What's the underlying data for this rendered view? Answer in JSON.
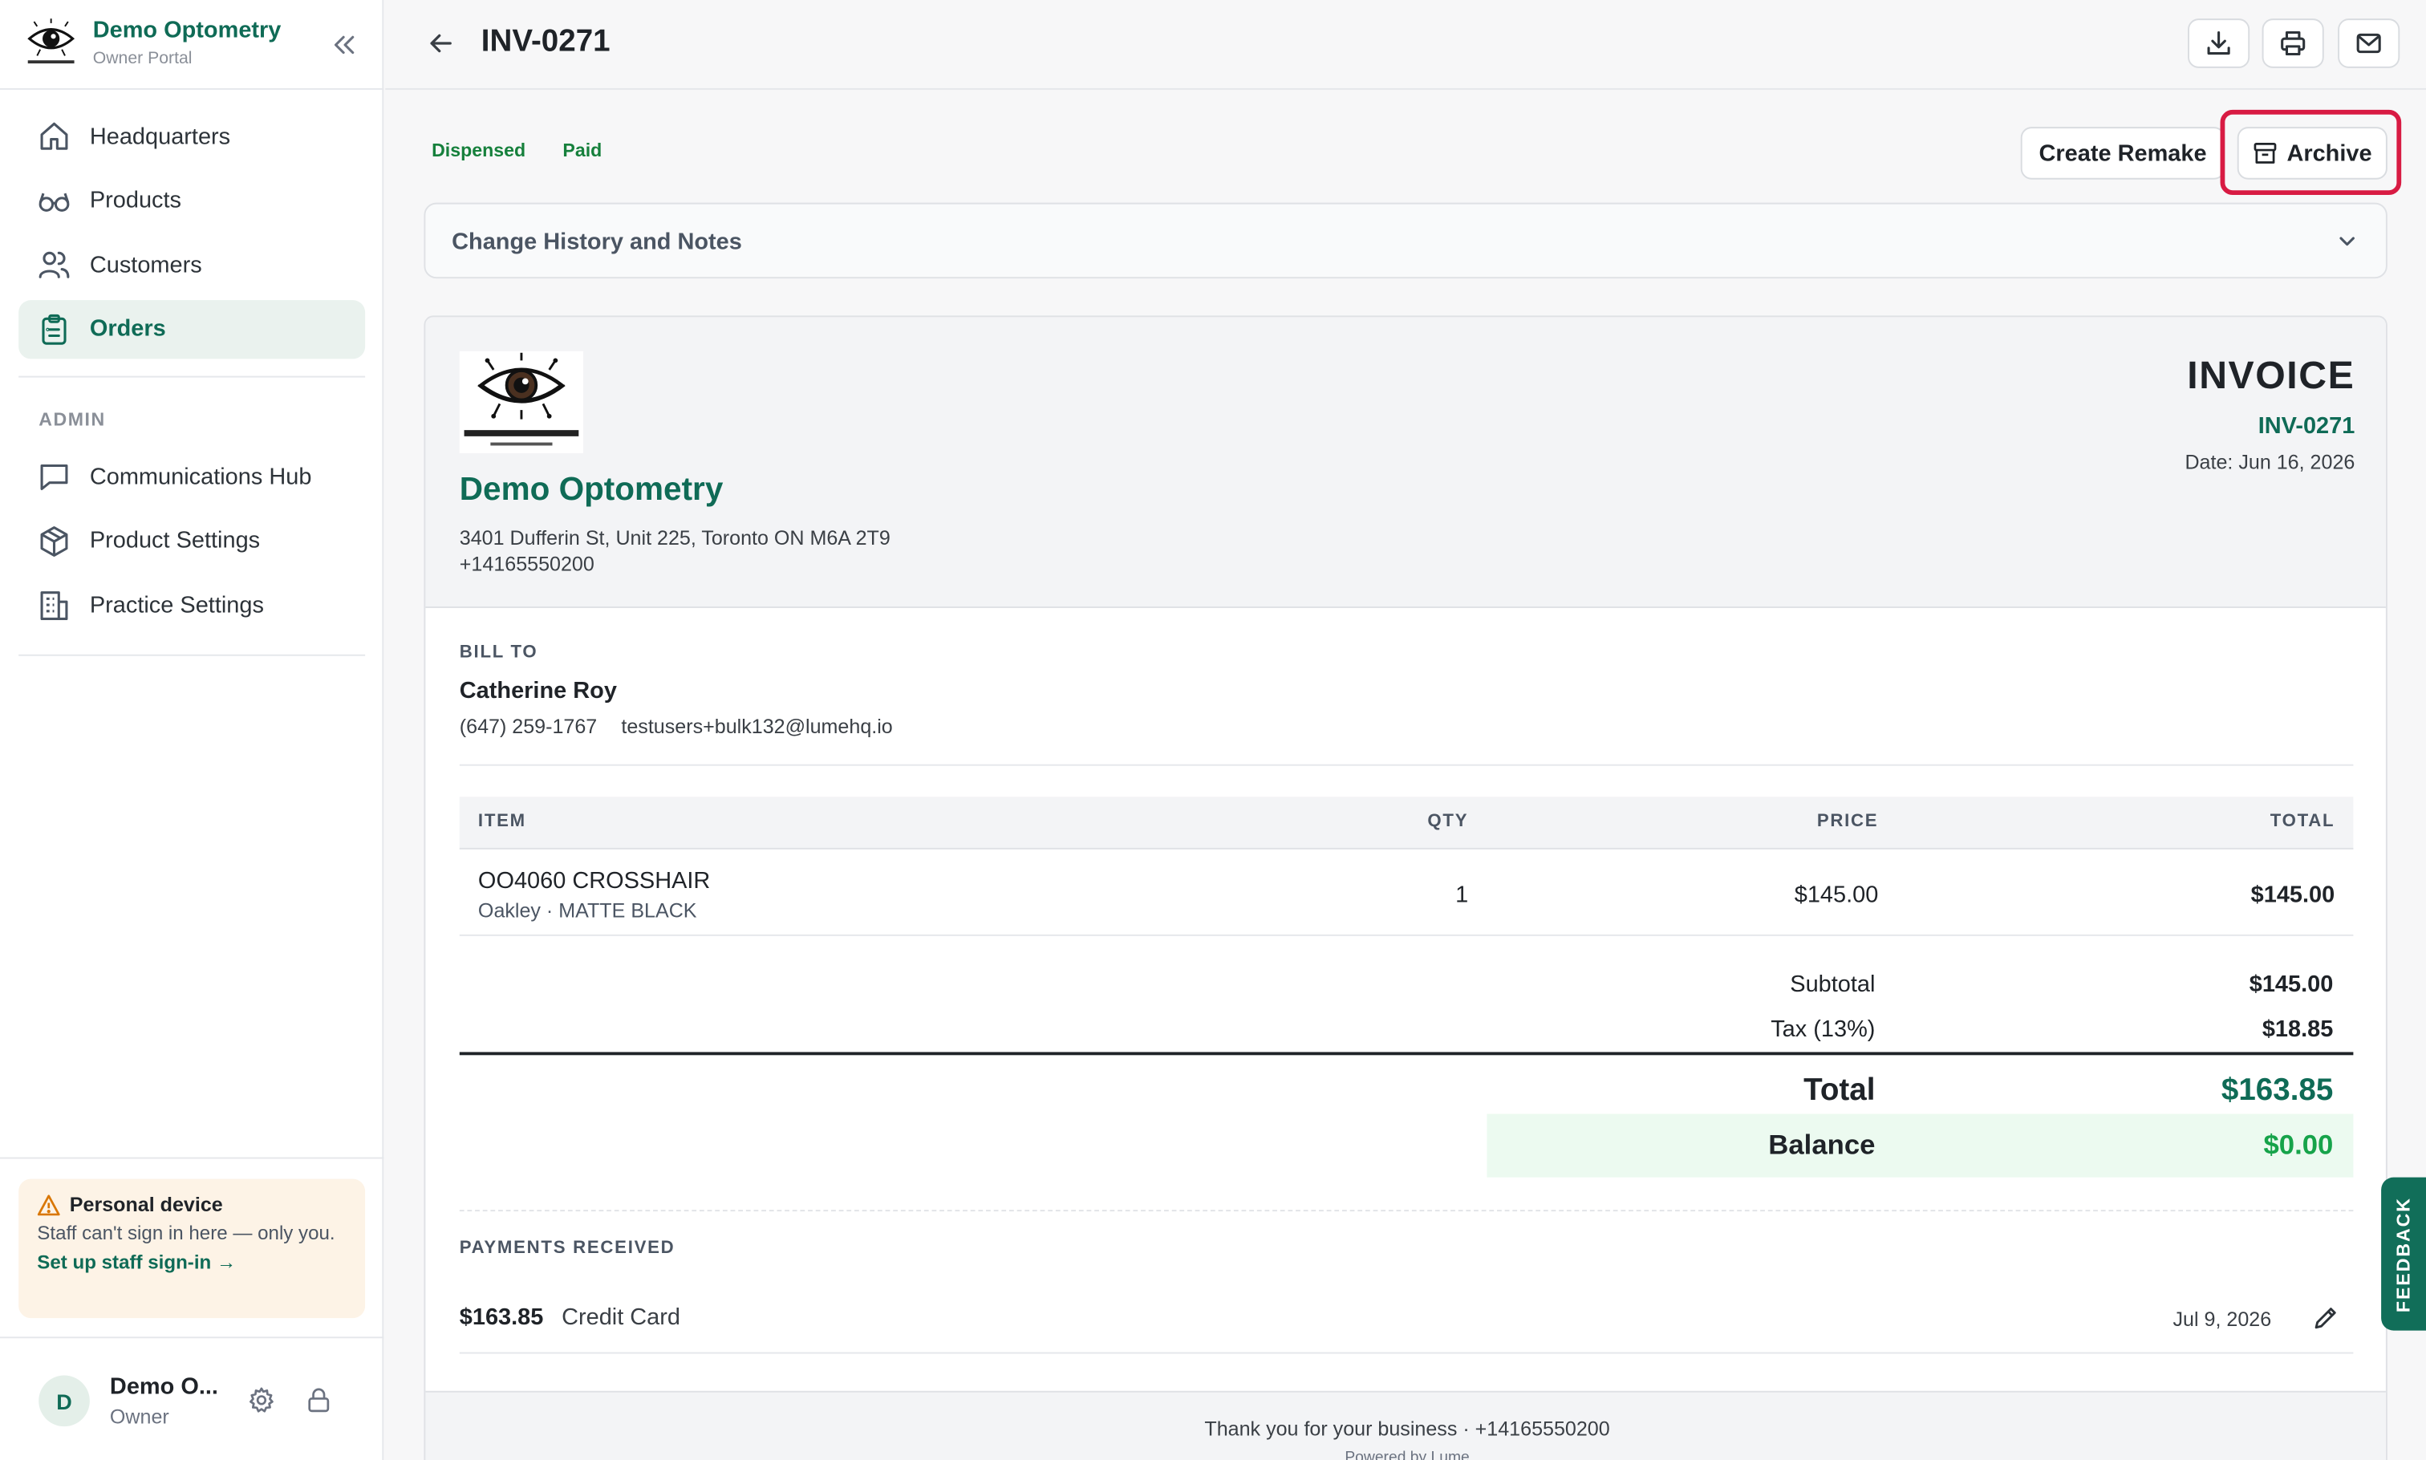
{
  "brand": {
    "name": "Demo Optometry",
    "subtitle": "Owner Portal"
  },
  "nav": [
    {
      "label": "Headquarters",
      "icon": "home-icon",
      "active": false
    },
    {
      "label": "Products",
      "icon": "glasses-icon",
      "active": false
    },
    {
      "label": "Customers",
      "icon": "users-icon",
      "active": false
    },
    {
      "label": "Orders",
      "icon": "clipboard-icon",
      "active": true
    }
  ],
  "admin": {
    "section_label": "ADMIN",
    "items": [
      {
        "label": "Communications Hub",
        "icon": "message-icon"
      },
      {
        "label": "Product Settings",
        "icon": "box-icon"
      },
      {
        "label": "Practice Settings",
        "icon": "building-icon"
      }
    ]
  },
  "device_notice": {
    "title": "Personal device",
    "text": "Staff can't sign in here — only you.",
    "link": "Set up staff sign-in →"
  },
  "user": {
    "initial": "D",
    "name": "Demo O...",
    "role": "Owner"
  },
  "header": {
    "title": "INV-0271"
  },
  "status_badges": [
    "Dispensed",
    "Paid"
  ],
  "actions": {
    "remake": "Create Remake",
    "archive": "Archive"
  },
  "accordion": {
    "title": "Change History and Notes"
  },
  "invoice": {
    "heading": "INVOICE",
    "number": "INV-0271",
    "date": "Date: Jun 16, 2026",
    "company": "Demo Optometry",
    "address": "3401 Dufferin St, Unit 225, Toronto ON M6A 2T9",
    "phone": "+14165550200",
    "bill_to_label": "BILL TO",
    "customer": {
      "name": "Catherine Roy",
      "phone": "(647) 259-1767",
      "email": "testusers+bulk132@lumehq.io"
    },
    "columns": {
      "item": "ITEM",
      "qty": "QTY",
      "price": "PRICE",
      "total": "TOTAL"
    },
    "items": [
      {
        "name": "OO4060 CROSSHAIR",
        "detail": "Oakley · MATTE BLACK",
        "qty": "1",
        "price": "$145.00",
        "total": "$145.00"
      }
    ],
    "subtotal_label": "Subtotal",
    "subtotal": "$145.00",
    "tax_label": "Tax (13%)",
    "tax": "$18.85",
    "total_label": "Total",
    "total": "$163.85",
    "balance_label": "Balance",
    "balance": "$0.00",
    "payments_label": "PAYMENTS RECEIVED",
    "payments": [
      {
        "amount": "$163.85",
        "method": "Credit Card",
        "date": "Jul 9, 2026"
      }
    ],
    "footer_text": "Thank you for your business · +14165550200",
    "footer_sub": "Powered by Lume"
  },
  "feedback_label": "FEEDBACK",
  "colors": {
    "brand": "#0f6b56",
    "paid": "#16803c",
    "balance": "#16a34a",
    "highlight": "#d81b43",
    "warning_bg": "#fdf3e6"
  }
}
